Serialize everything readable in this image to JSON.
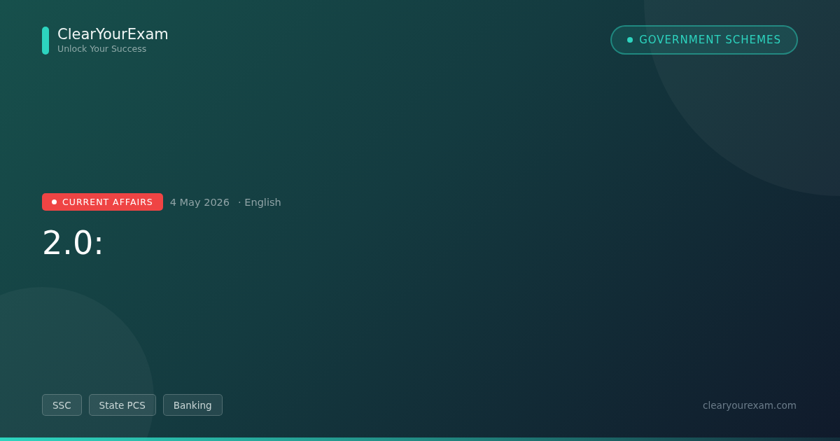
{
  "brand": {
    "name": "ClearYourExam",
    "tagline": "Unlock Your Success"
  },
  "category_pill": "GOVERNMENT SCHEMES",
  "meta": {
    "badge": "CURRENT AFFAIRS",
    "date": "4 May 2026",
    "language": "· English"
  },
  "title": "2.0:",
  "tags": [
    "SSC",
    "State PCS",
    "Banking"
  ],
  "website": "clearyourexam.com"
}
